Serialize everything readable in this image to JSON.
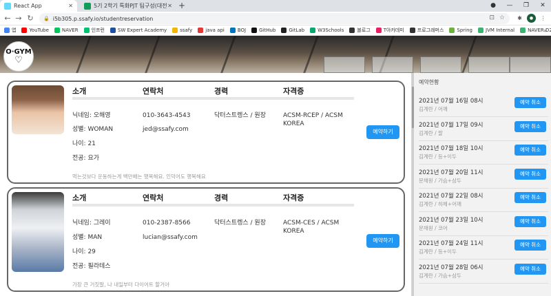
{
  "browser": {
    "tabs": [
      {
        "title": "React App",
        "active": true
      },
      {
        "title": "5기 2학기 특화PJT 팀구성(대전…",
        "active": false
      }
    ],
    "url": "i5b305.p.ssafy.io/studentreservation",
    "bookmarks": [
      {
        "label": "앱",
        "color": "#4285f4"
      },
      {
        "label": "YouTube",
        "color": "#ff0000"
      },
      {
        "label": "NAVER",
        "color": "#03c75a"
      },
      {
        "label": "인프런",
        "color": "#00c471"
      },
      {
        "label": "SW Expert Academy",
        "color": "#1e4fa1"
      },
      {
        "label": "ssafy",
        "color": "#f7b500"
      },
      {
        "label": "java api",
        "color": "#e53935"
      },
      {
        "label": "BOJ",
        "color": "#0076c0"
      },
      {
        "label": "GitHub",
        "color": "#111111"
      },
      {
        "label": "GitLab",
        "color": "#222222"
      },
      {
        "label": "W3Schools",
        "color": "#04aa6d"
      },
      {
        "label": "블로그",
        "color": "#333333"
      },
      {
        "label": "T아카데미",
        "color": "#e91e63"
      },
      {
        "label": "프로그래머스",
        "color": "#333333"
      },
      {
        "label": "Spring",
        "color": "#6db33f"
      },
      {
        "label": "JVM Internal",
        "color": "#3cb371"
      },
      {
        "label": "NAVER D2",
        "color": "#3cb371"
      }
    ],
    "more_label": "»"
  },
  "logo": {
    "top": "O·GYM",
    "bottom": "♡"
  },
  "columns": {
    "intro": "소개",
    "contact": "연락처",
    "career": "경력",
    "cert": "자격증"
  },
  "trainers": [
    {
      "nickname": "닉네임: 오해영",
      "gender": "성별: WOMAN",
      "age": "나이: 21",
      "major": "전공: 요가",
      "phone": "010-3643-4543",
      "email": "jed@ssafy.com",
      "career": "닥터스트렝스 / 원장",
      "cert": "ACSM-RCEP / ACSM KOREA",
      "intro": "먹는것보다 운동하는게 백만배는 행복해요. 인덕어도 행복해요",
      "button": "예약하기"
    },
    {
      "nickname": "닉네임: 그레이",
      "gender": "성별: MAN",
      "age": "나이: 29",
      "major": "전공: 필라테스",
      "phone": "010-2387-8566",
      "email": "lucian@ssafy.com",
      "career": "닥터스트렝스 / 원장",
      "cert": "ACSM-CES / ACSM KOREA",
      "intro": "가장 큰 거짓말, 나 내일부터 다이어트 할거야",
      "button": "예약하기"
    }
  ],
  "sidebar": {
    "title": "예약현황",
    "cancel_label": "예약 취소",
    "items": [
      {
        "datetime": "2021년 07월 16일 08시",
        "who": "김계란 / 어깨"
      },
      {
        "datetime": "2021년 07월 17일 09시",
        "who": "김계란 / 팔"
      },
      {
        "datetime": "2021년 07월 18일 10시",
        "who": "김계란 / 등+이두"
      },
      {
        "datetime": "2021년 07월 20일 11시",
        "who": "문채원 / 가슴+삼두"
      },
      {
        "datetime": "2021년 07월 22일 08시",
        "who": "김계란 / 하체+어깨"
      },
      {
        "datetime": "2021년 07월 23일 10시",
        "who": "문채원 / 코어"
      },
      {
        "datetime": "2021년 07월 24일 11시",
        "who": "김계란 / 등+이두"
      },
      {
        "datetime": "2021년 07월 28일 06시",
        "who": "김계란 / 가슴+삼두"
      }
    ]
  }
}
